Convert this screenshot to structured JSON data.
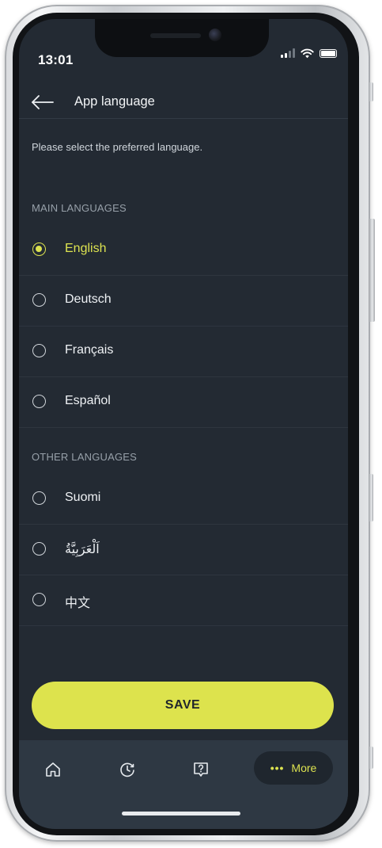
{
  "status_bar": {
    "time": "13:01",
    "icons": [
      "signal-icon",
      "wifi-icon",
      "battery-icon"
    ]
  },
  "header": {
    "title": "App language",
    "back_icon": "arrow-left-icon"
  },
  "intro_text": "Please select the preferred language.",
  "main_section": {
    "label": "MAIN LANGUAGES",
    "items": [
      {
        "label": "English",
        "selected": true
      },
      {
        "label": "Deutsch",
        "selected": false
      },
      {
        "label": "Français",
        "selected": false
      },
      {
        "label": "Español",
        "selected": false
      }
    ]
  },
  "other_section": {
    "label": "OTHER LANGUAGES",
    "items": [
      {
        "label": "Suomi",
        "selected": false
      },
      {
        "label": "اَلْعَرَبِيَّةُ",
        "selected": false
      },
      {
        "label": "中文",
        "selected": false
      }
    ]
  },
  "save_button": {
    "label": "SAVE"
  },
  "bottom_nav": {
    "items": [
      {
        "icon": "home-icon"
      },
      {
        "icon": "history-icon"
      },
      {
        "icon": "help-icon"
      }
    ],
    "more": {
      "icon": "more-dots-icon",
      "dots": "•••",
      "label": "More"
    }
  },
  "colors": {
    "background": "#232a33",
    "accent": "#dde34d",
    "nav_background": "#2e3843",
    "text": "#eef1f4",
    "muted_text": "#97a0a9"
  }
}
